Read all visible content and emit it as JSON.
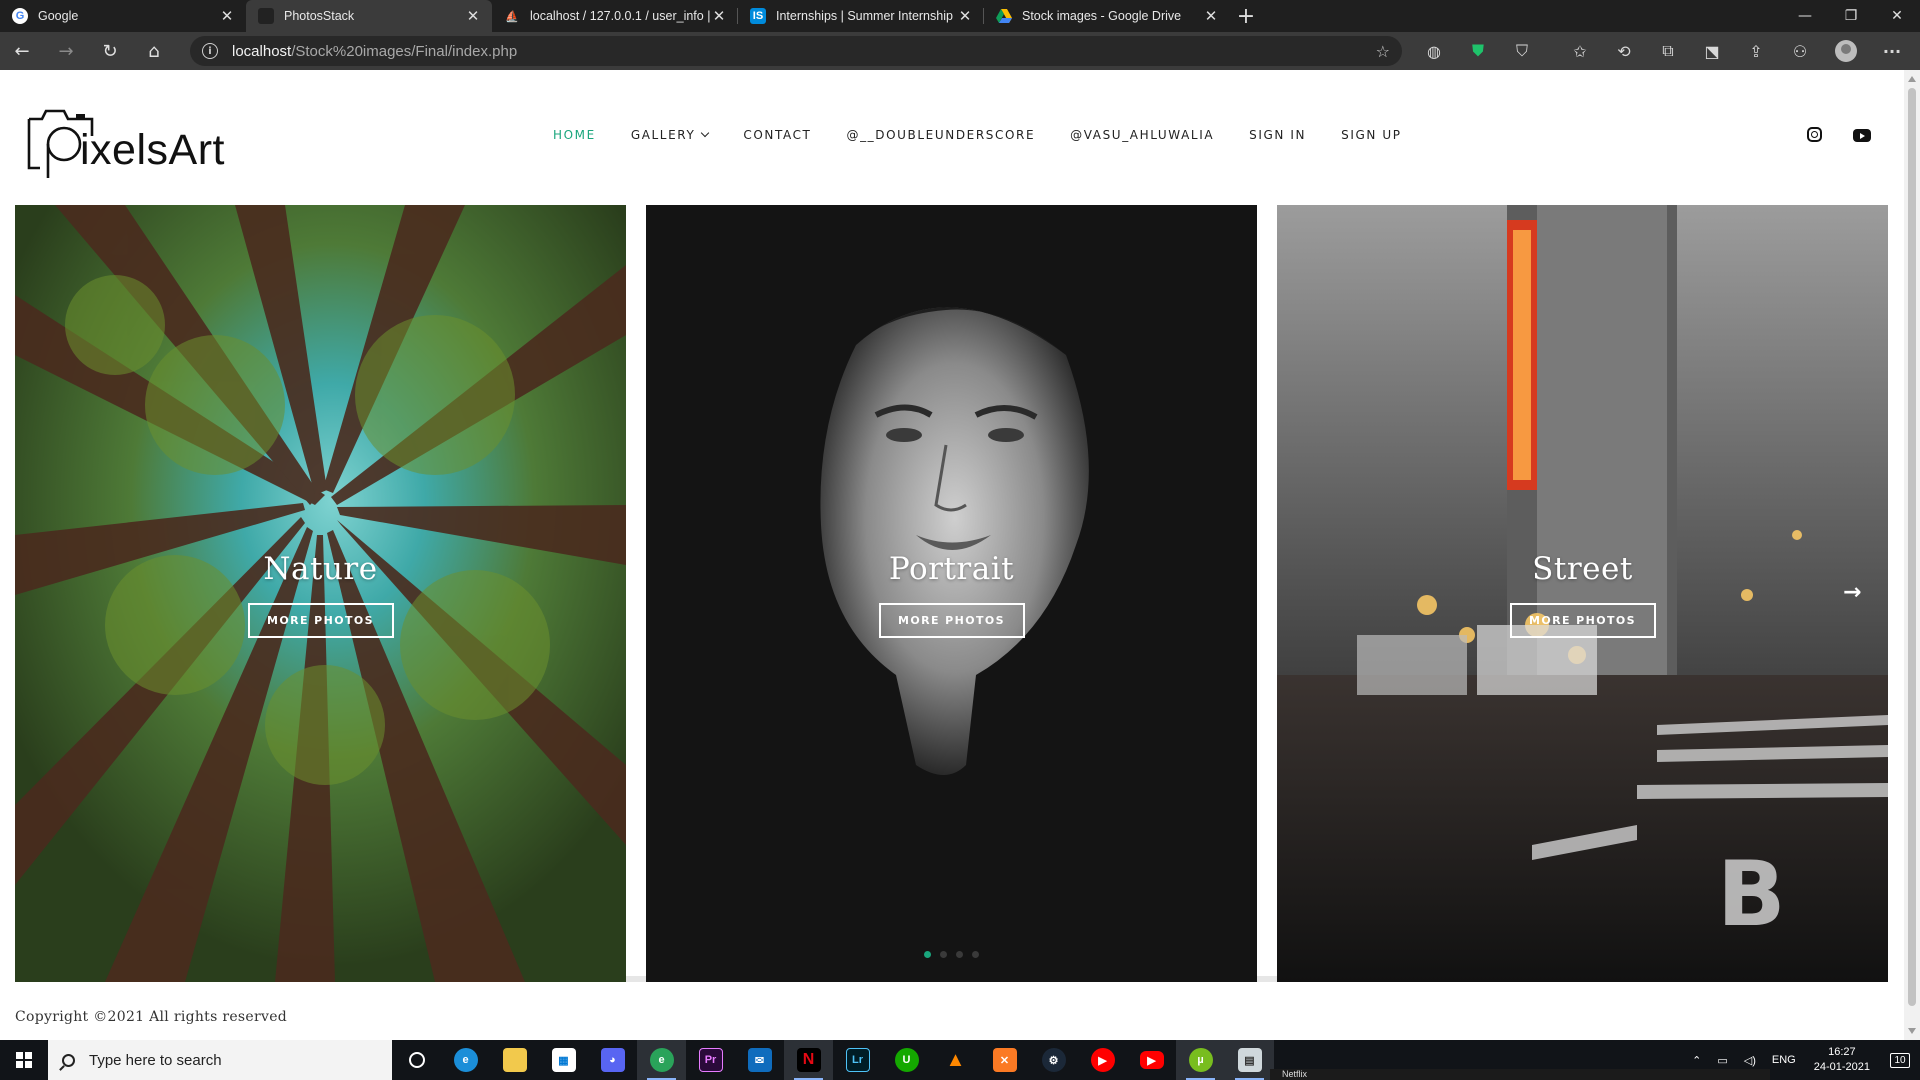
{
  "browser": {
    "tabs": [
      {
        "title": "Google",
        "favicon": "google-icon",
        "active": false
      },
      {
        "title": "PhotosStack",
        "favicon": "photosstack-icon",
        "active": true
      },
      {
        "title": "localhost / 127.0.0.1 / user_info |",
        "favicon": "phpmyadmin-icon",
        "active": false
      },
      {
        "title": "Internships | Summer Internship",
        "favicon": "internshala-icon",
        "active": false
      },
      {
        "title": "Stock images - Google Drive",
        "favicon": "google-drive-icon",
        "active": false
      }
    ],
    "url_host": "localhost",
    "url_path": "/Stock%20images/Final/index.php"
  },
  "site": {
    "logo_text": "ixelsArt",
    "nav": [
      {
        "label": "HOME",
        "active": true
      },
      {
        "label": "GALLERY",
        "has_dropdown": true
      },
      {
        "label": "CONTACT"
      },
      {
        "label": "@__DOUBLEUNDERSCORE"
      },
      {
        "label": "@VASU_AHLUWALIA"
      },
      {
        "label": "SIGN IN"
      },
      {
        "label": "SIGN UP"
      }
    ],
    "social": [
      "instagram-icon",
      "youtube-icon"
    ],
    "accent_color": "#1aa67d",
    "gallery": [
      {
        "title": "Nature",
        "button": "MORE PHOTOS"
      },
      {
        "title": "Portrait",
        "button": "MORE PHOTOS"
      },
      {
        "title": "Street",
        "button": "MORE PHOTOS"
      }
    ],
    "slider_dots": 4,
    "slider_active_dot": 0,
    "footer": "Copyright ©2021 All rights reserved"
  },
  "taskbar": {
    "search_placeholder": "Type here to search",
    "apps": [
      "task-view-icon",
      "edge-icon",
      "file-explorer-icon",
      "store-icon",
      "discord-icon",
      "edge-dev-icon",
      "premiere-icon",
      "mail-icon",
      "netflix-icon",
      "lightroom-icon",
      "upwork-icon",
      "vlc-icon",
      "xampp-icon",
      "steam-icon",
      "youtube-music-icon",
      "youtube-icon",
      "utorrent-icon",
      "notepad-icon"
    ],
    "language": "ENG",
    "time": "16:27",
    "date": "24-01-2021",
    "notifications": "10",
    "popup_title": "Netflix"
  }
}
